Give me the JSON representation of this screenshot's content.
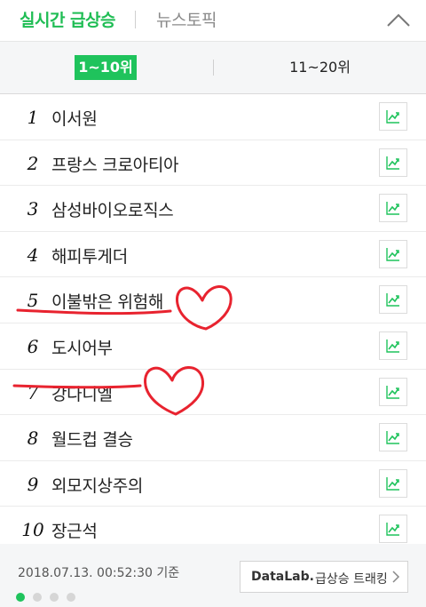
{
  "header": {
    "active_tab": "실시간 급상승",
    "other_tab": "뉴스토픽",
    "collapse_icon": "chevron-up-icon"
  },
  "segments": {
    "left": "1~10위",
    "right": "11~20위",
    "active": "left"
  },
  "ranking": [
    {
      "rank": "1",
      "keyword": "이서원"
    },
    {
      "rank": "2",
      "keyword": "프랑스 크로아티아"
    },
    {
      "rank": "3",
      "keyword": "삼성바이오로직스"
    },
    {
      "rank": "4",
      "keyword": "해피투게더"
    },
    {
      "rank": "5",
      "keyword": "이불밖은 위험해"
    },
    {
      "rank": "6",
      "keyword": "도시어부"
    },
    {
      "rank": "7",
      "keyword": "강다니엘"
    },
    {
      "rank": "8",
      "keyword": "월드컵 결승"
    },
    {
      "rank": "9",
      "keyword": "외모지상주의"
    },
    {
      "rank": "10",
      "keyword": "장근석"
    }
  ],
  "row_icon": "trend-chart-icon",
  "footer": {
    "timestamp": "2018.07.13. 00:52:30 기준",
    "datalab_brand": "DataLab.",
    "datalab_text": "급상승 트래킹",
    "page_dots": 4,
    "active_dot": 1
  },
  "colors": {
    "accent": "#1fc35c",
    "annotation": "#e8232f"
  }
}
